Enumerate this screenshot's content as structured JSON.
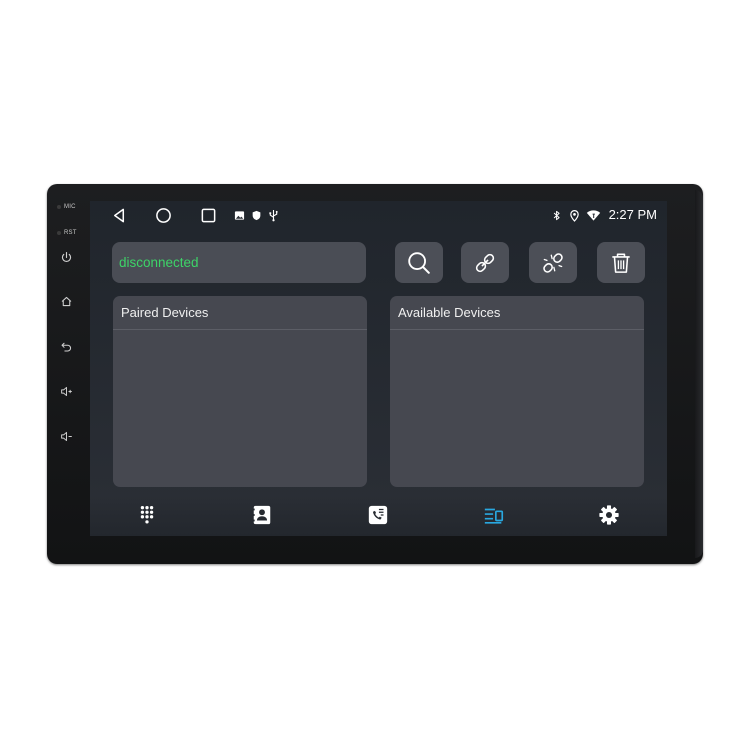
{
  "device": {
    "labels": {
      "mic": "MIC",
      "rst": "RST"
    },
    "side_buttons": [
      "power-icon",
      "home-icon",
      "back-icon",
      "volume-up-icon",
      "volume-down-icon"
    ]
  },
  "statusbar": {
    "left_icons": [
      "back-triangle-icon",
      "home-circle-icon",
      "recent-apps-icon",
      "image-icon",
      "shield-icon",
      "usb-icon"
    ],
    "right_icons": [
      "bluetooth-icon",
      "location-icon",
      "wifi-icon"
    ],
    "time": "2:27 PM"
  },
  "bluetooth": {
    "status": "disconnected",
    "status_color": "#3dd468",
    "toolbar": [
      "search-icon",
      "link-icon",
      "unlink-icon",
      "trash-icon"
    ],
    "panels": {
      "paired": {
        "title": "Paired Devices"
      },
      "available": {
        "title": "Available Devices"
      }
    }
  },
  "bottom_nav": {
    "items": [
      "dialpad-icon",
      "contacts-icon",
      "call-log-icon",
      "music-devices-icon",
      "settings-icon"
    ],
    "active_index": 3,
    "active_color": "#29a8e0"
  }
}
